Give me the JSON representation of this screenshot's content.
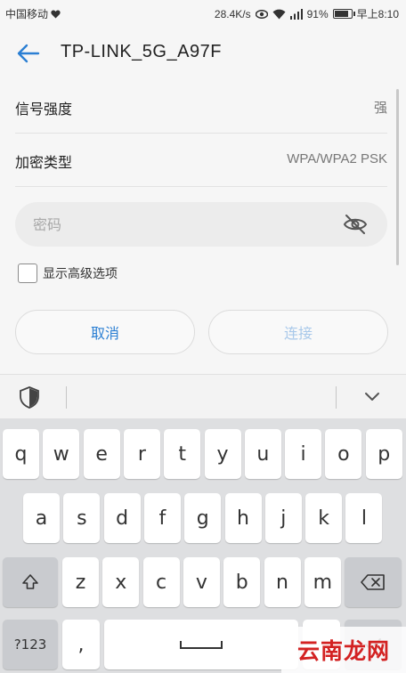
{
  "status_bar": {
    "carrier": "中国移动",
    "speed": "28.4K/s",
    "battery": "91%",
    "battery_level": 0.91,
    "time": "早上8:10"
  },
  "header": {
    "title": "TP-LINK_5G_A97F"
  },
  "rows": [
    {
      "label": "信号强度",
      "value": "强"
    },
    {
      "label": "加密类型",
      "value": "WPA/WPA2 PSK"
    }
  ],
  "password": {
    "placeholder": "密码",
    "value": ""
  },
  "advanced": {
    "label": "显示高级选项",
    "checked": false
  },
  "buttons": {
    "cancel": "取消",
    "connect": "连接"
  },
  "keyboard": {
    "row1": [
      "q",
      "w",
      "e",
      "r",
      "t",
      "y",
      "u",
      "i",
      "o",
      "p"
    ],
    "row2": [
      "a",
      "s",
      "d",
      "f",
      "g",
      "h",
      "j",
      "k",
      "l"
    ],
    "row3": [
      "z",
      "x",
      "c",
      "v",
      "b",
      "n",
      "m"
    ],
    "num_key": "?123",
    "comma": ","
  },
  "watermark": "云南龙网",
  "colors": {
    "accent": "#2b7fd3",
    "disabled": "#a9c9ea",
    "watermark": "#d32222"
  }
}
